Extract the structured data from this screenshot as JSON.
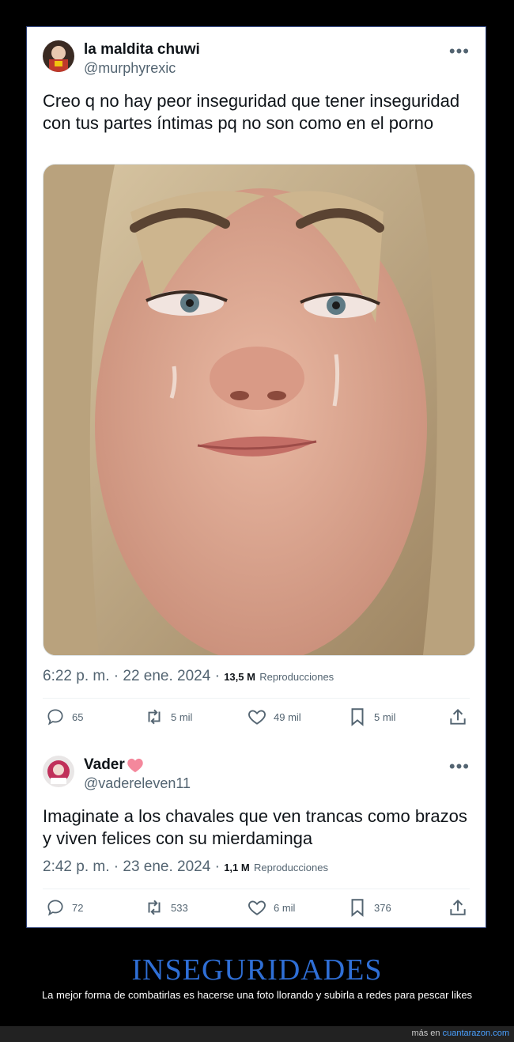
{
  "tweets": [
    {
      "display_name": "la maldita chuwi",
      "handle": "@murphyrexic",
      "more": "•••",
      "text": "Creo q no hay peor inseguridad que tener inseguridad con tus partes íntimas pq no son como en el porno",
      "time": "6:22 p. m. · 22 ene. 2024 ·",
      "views_count": "13,5 M",
      "views_label": "Reproducciones",
      "replies": "65",
      "retweets": "5 mil",
      "likes": "49 mil",
      "bookmarks": "5 mil"
    },
    {
      "display_name": "Vader",
      "handle": "@vadereleven11",
      "more": "•••",
      "text": "Imaginate a los chavales que ven trancas como brazos y viven felices con su mierdaminga",
      "time": "2:42 p. m. · 23 ene. 2024 ·",
      "views_count": "1,1 M",
      "views_label": "Reproducciones",
      "replies": "72",
      "retweets": "533",
      "likes": "6 mil",
      "bookmarks": "376"
    }
  ],
  "caption": {
    "title": "INSEGURIDADES",
    "subtitle": "La mejor forma de combatirlas es hacerse una foto llorando y subirla a redes para pescar likes"
  },
  "footer": {
    "prefix": "más en",
    "link": "cuantarazon.com"
  },
  "icons": {
    "reply": "reply-icon",
    "retweet": "retweet-icon",
    "like": "heart-icon",
    "bookmark": "bookmark-icon",
    "share": "share-icon"
  },
  "colors": {
    "accent": "#2f6fd6",
    "heart": "#f4889c"
  }
}
